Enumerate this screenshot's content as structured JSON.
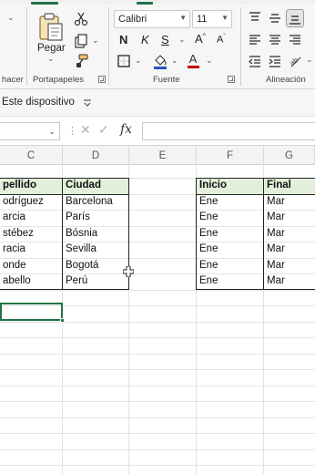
{
  "ribbon": {
    "groups": {
      "portapapeles": "Portapapeles",
      "fuente": "Fuente",
      "alineacion": "Alineación",
      "left_cut": "hacer"
    },
    "paste_label": "Pegar",
    "font_name": "Calibri",
    "font_size": "11",
    "bold": "N",
    "italic": "K",
    "underline": "S",
    "grow_font": "A",
    "shrink_font": "A",
    "font_color_letter": "A",
    "icons": [
      "paste-icon",
      "cut-icon",
      "copy-icon",
      "format-painter-icon",
      "borders-icon",
      "fill-color-icon",
      "font-color-icon",
      "align-top-icon",
      "align-middle-icon",
      "align-bottom-icon",
      "align-left-icon",
      "align-center-icon",
      "align-right-icon",
      "decrease-indent-icon",
      "increase-indent-icon",
      "orientation-icon",
      "wrap-text-icon"
    ]
  },
  "sheetbar": {
    "location": "Este dispositivo"
  },
  "formulabar": {
    "fx": "fx",
    "value": ""
  },
  "columns": [
    "C",
    "D",
    "E",
    "F",
    "G"
  ],
  "table1": {
    "headers": [
      "pellido",
      "Ciudad"
    ],
    "rows": [
      [
        "odríguez",
        "Barcelona"
      ],
      [
        "arcia",
        "París"
      ],
      [
        "stébez",
        "Bósnia"
      ],
      [
        "racia",
        "Sevilla"
      ],
      [
        "onde",
        "Bogotá"
      ],
      [
        "abello",
        "Perú"
      ]
    ]
  },
  "table2": {
    "headers": [
      "Inicio",
      "Final"
    ],
    "rows": [
      [
        "Ene",
        "Mar"
      ],
      [
        "Ene",
        "Mar"
      ],
      [
        "Ene",
        "Mar"
      ],
      [
        "Ene",
        "Mar"
      ],
      [
        "Ene",
        "Mar"
      ],
      [
        "Ene",
        "Mar"
      ]
    ]
  },
  "colors": {
    "accent": "#217346",
    "header_fill": "#e2efda",
    "ribbon_bg": "#f6f6f6"
  }
}
